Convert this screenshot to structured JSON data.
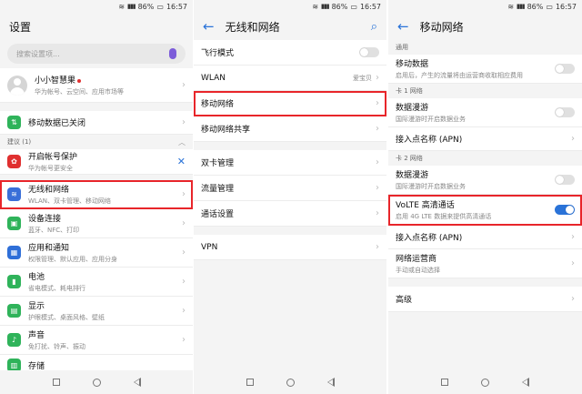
{
  "status": {
    "wifi": "≋",
    "signal": "▮▮▮",
    "battery": "86%",
    "battery_icon": "▭",
    "time": "16:57"
  },
  "screen1": {
    "title": "设置",
    "search_placeholder": "搜索设置项...",
    "account": {
      "name": "小小智慧果",
      "sub": "华为帐号、云空间、应用市场等"
    },
    "mobile_data": "移动数据已关闭",
    "suggestion_header": "建议 (1)",
    "suggestion": {
      "title": "开启帐号保护",
      "sub": "华为帐号更安全"
    },
    "items": [
      {
        "title": "无线和网络",
        "sub": "WLAN、双卡管理、移动网络",
        "color": "#3a6fd8"
      },
      {
        "title": "设备连接",
        "sub": "蓝牙、NFC、打印",
        "color": "#2fb35a"
      },
      {
        "title": "应用和通知",
        "sub": "权限管理、默认应用、应用分身",
        "color": "#2f6fd8"
      },
      {
        "title": "电池",
        "sub": "省电模式、耗电排行",
        "color": "#2fb35a"
      },
      {
        "title": "显示",
        "sub": "护眼模式、桌面风格、壁纸",
        "color": "#2fb35a"
      },
      {
        "title": "声音",
        "sub": "免打扰、铃声、振动",
        "color": "#2fb35a"
      },
      {
        "title": "存储",
        "sub": "",
        "color": "#2fb35a"
      }
    ]
  },
  "screen2": {
    "title": "无线和网络",
    "airplane": "飞行模式",
    "wlan": {
      "label": "WLAN",
      "value": "爱宝贝"
    },
    "mobile_network": "移动网络",
    "hotspot": "移动网络共享",
    "dual_sim": "双卡管理",
    "data_usage": "流量管理",
    "call_settings": "通话设置",
    "vpn": "VPN"
  },
  "screen3": {
    "title": "移动网络",
    "general": "通用",
    "mobile_data": {
      "title": "移动数据",
      "sub": "启用后，产生的流量将由运营商收取相应费用"
    },
    "sim1_header": "卡 1 网络",
    "sim1_roaming": {
      "title": "数据漫游",
      "sub": "国际漫游时开启数据业务"
    },
    "sim1_apn": "接入点名称 (APN)",
    "sim2_header": "卡 2 网络",
    "sim2_roaming": {
      "title": "数据漫游",
      "sub": "国际漫游时开启数据业务"
    },
    "volte": {
      "title": "VoLTE 高清通话",
      "sub": "启用 4G LTE 数据来提供高清通话"
    },
    "sim2_apn": "接入点名称 (APN)",
    "operator": {
      "title": "网络运营商",
      "sub": "手动或自动选择"
    },
    "advanced": "高级"
  },
  "colors": {
    "accent": "#2a73d8",
    "highlight": "#e8252a"
  }
}
